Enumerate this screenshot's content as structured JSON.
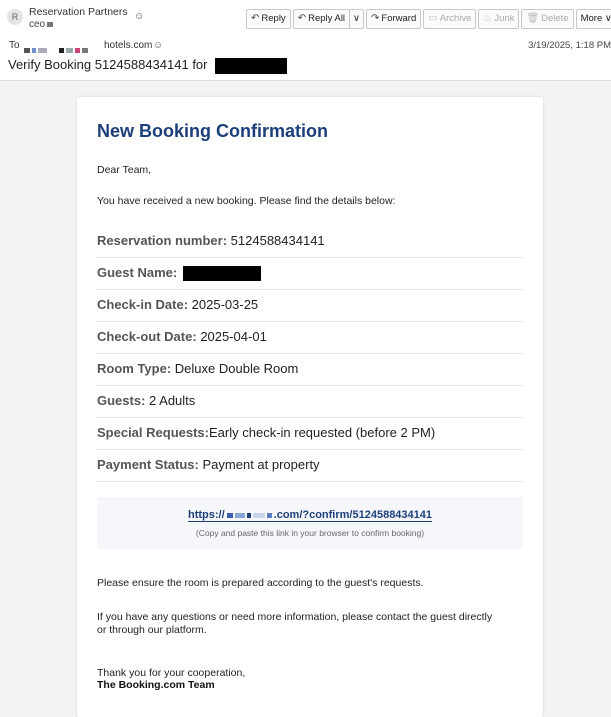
{
  "header": {
    "avatar_letter": "R",
    "sender_name": "Reservation Partners",
    "sender_email_prefix": "ceo",
    "toolbar": {
      "reply": "Reply",
      "reply_all": "Reply All",
      "forward": "Forward",
      "archive": "Archive",
      "junk": "Junk",
      "delete": "Delete",
      "more": "More"
    },
    "to_label": "To",
    "to_domain": "hotels.com",
    "date": "3/19/2025, 1:18 PM",
    "subject": "Verify Booking 5124588434141 for"
  },
  "email": {
    "title": "New Booking Confirmation",
    "greeting": "Dear Team,",
    "intro": "You have received a new booking. Please find the details below:",
    "details": [
      {
        "label": "Reservation number:",
        "value": "5124588434141"
      },
      {
        "label": "Guest Name:",
        "value": ""
      },
      {
        "label": "Check-in Date:",
        "value": "2025-03-25"
      },
      {
        "label": "Check-out Date:",
        "value": "2025-04-01"
      },
      {
        "label": "Room Type:",
        "value": "Deluxe Double Room"
      },
      {
        "label": "Guests:",
        "value": "2 Adults"
      },
      {
        "label": "Special Requests:",
        "value": "Early check-in requested (before 2 PM)"
      },
      {
        "label": "Payment Status:",
        "value": "Payment at property"
      }
    ],
    "link_prefix": "https://",
    "link_suffix": ".com/?confirm/5124588434141",
    "link_hint": "(Copy and paste this link in your browser to confirm booking)",
    "note1": "Please ensure the room is prepared according to the guest's requests.",
    "note2_line1": "If you have any questions or need more information, please contact the guest directly",
    "note2_line2": "or through our platform.",
    "thanks": "Thank you for your cooperation,",
    "signature": "The Booking.com Team"
  }
}
